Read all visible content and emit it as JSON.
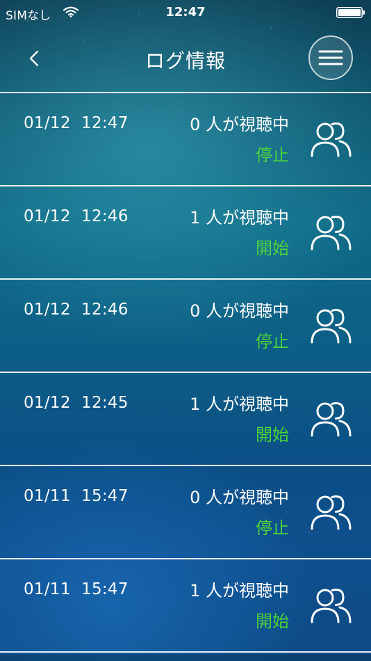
{
  "status_bar": {
    "carrier": "SIMなし",
    "time": "12:47",
    "wifi_icon": "wifi-icon",
    "battery_icon": "battery-icon"
  },
  "nav": {
    "title": "ログ情報",
    "back_icon": "chevron-left-icon",
    "menu_icon": "hamburger-menu-icon"
  },
  "colors": {
    "state_text": "#4cd23c",
    "divider": "#ffffff"
  },
  "logs": [
    {
      "time": "01/12  12:47",
      "viewers": "0 人が視聴中",
      "state": "停止",
      "icon": "users-icon"
    },
    {
      "time": "01/12  12:46",
      "viewers": "1 人が視聴中",
      "state": "開始",
      "icon": "users-icon"
    },
    {
      "time": "01/12  12:46",
      "viewers": "0 人が視聴中",
      "state": "停止",
      "icon": "users-icon"
    },
    {
      "time": "01/12  12:45",
      "viewers": "1 人が視聴中",
      "state": "開始",
      "icon": "users-icon"
    },
    {
      "time": "01/11  15:47",
      "viewers": "0 人が視聴中",
      "state": "停止",
      "icon": "users-icon"
    },
    {
      "time": "01/11  15:47",
      "viewers": "1 人が視聴中",
      "state": "開始",
      "icon": "users-icon"
    }
  ]
}
